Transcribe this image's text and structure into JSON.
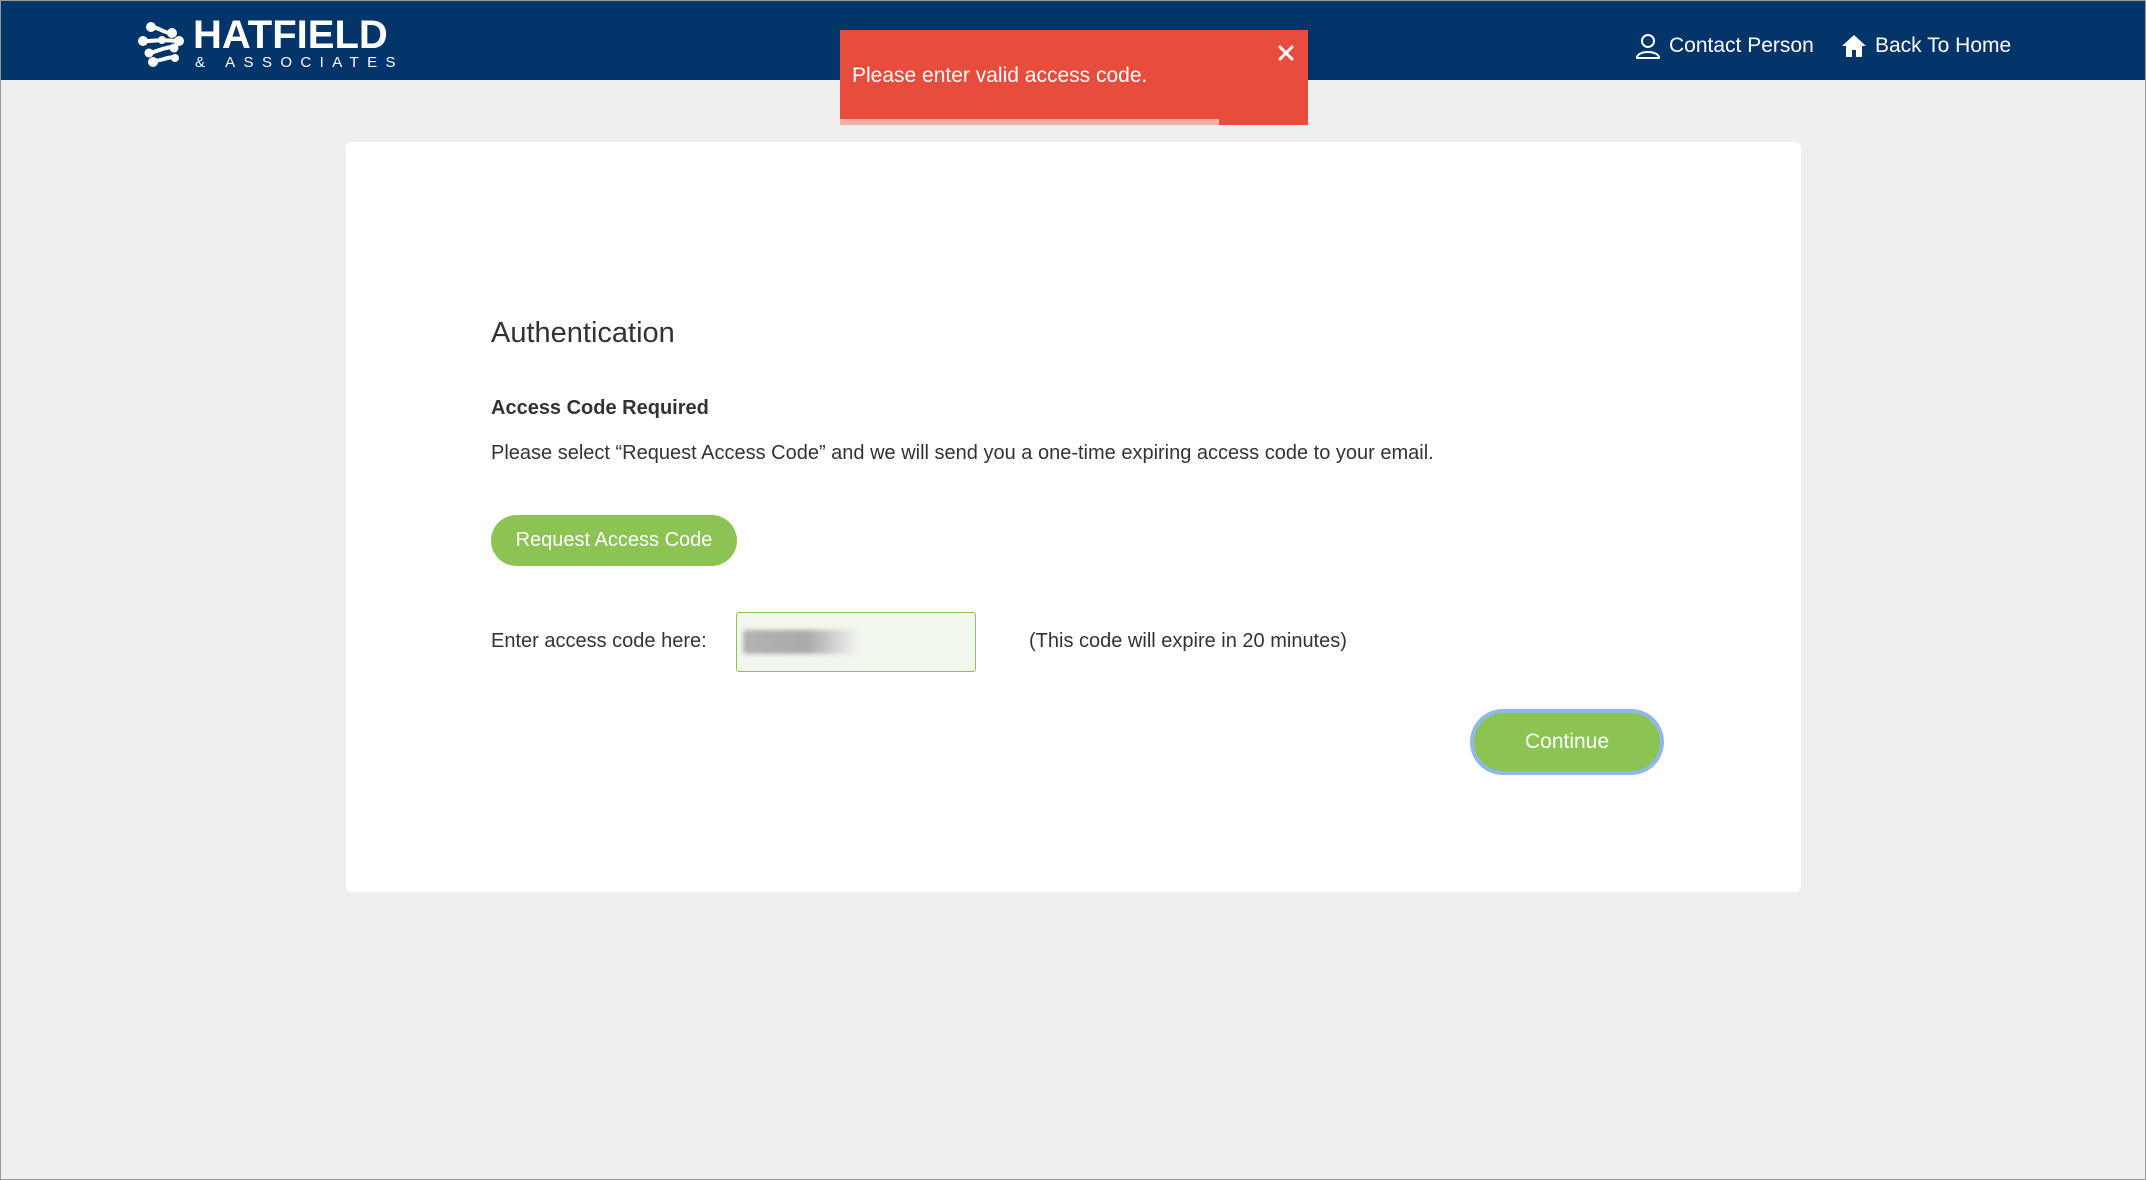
{
  "header": {
    "logo": {
      "name": "HATFIELD",
      "tagline": "& ASSOCIATES",
      "icon": "molecule-logo-icon"
    },
    "nav": {
      "contact_label": "Contact Person",
      "contact_icon": "user-icon",
      "home_label": "Back To Home",
      "home_icon": "home-icon"
    },
    "background_color": "#04356a"
  },
  "toast": {
    "message": "Please enter valid access code.",
    "close_icon": "close-icon",
    "background_color": "#e74c3c",
    "progress_fraction": 0.81
  },
  "auth": {
    "title": "Authentication",
    "subtitle": "Access Code Required",
    "description": "Please select “Request Access Code” and we will send you a one-time expiring access code to your email.",
    "request_button_label": "Request Access Code",
    "code_label": "Enter access code here:",
    "code_input_value": "",
    "expire_note": "(This code will expire in 20 minutes)",
    "continue_button_label": "Continue",
    "accent_color": "#8bc453"
  }
}
